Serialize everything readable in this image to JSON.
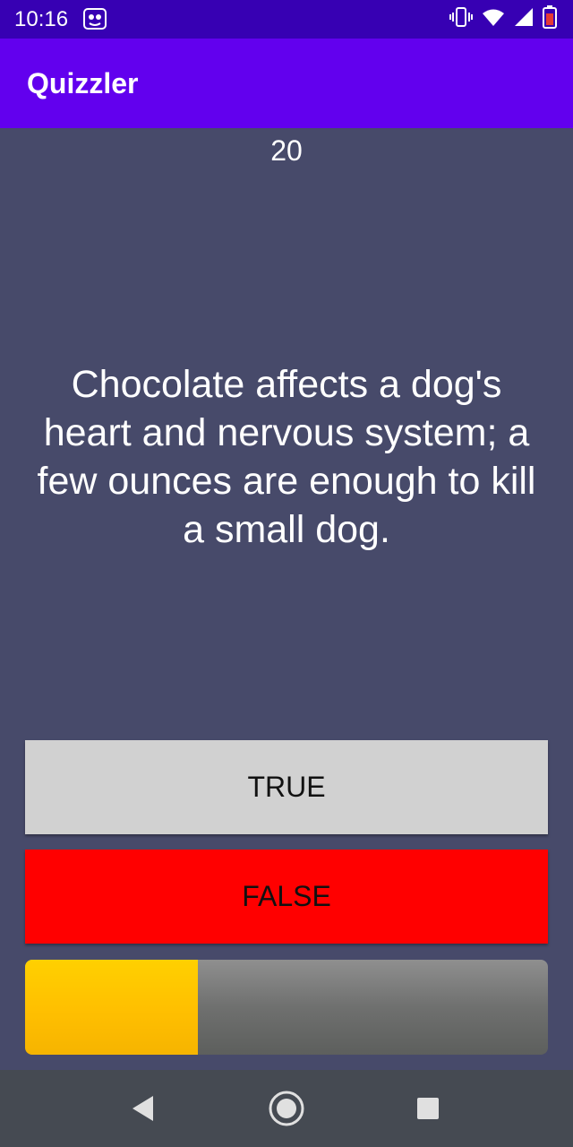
{
  "status_bar": {
    "time": "10:16",
    "notification_icon": "app-notification-icon",
    "icons": [
      "vibrate-icon",
      "wifi-icon",
      "signal-icon",
      "battery-low-icon"
    ],
    "battery_color": "#e53935"
  },
  "app_bar": {
    "title": "Quizzler",
    "color": "#6200ee"
  },
  "quiz": {
    "score": "20",
    "question": "Chocolate affects a dog's heart and nervous system; a few ounces are enough to kill a small dog.",
    "true_label": "TRUE",
    "false_label": "FALSE",
    "true_color": "#d1d1d1",
    "false_color": "#ff0000",
    "progress": 0.33,
    "progress_color": "#ffc400"
  },
  "nav_bar": {
    "icons": [
      "back-icon",
      "home-icon",
      "recents-icon"
    ]
  }
}
